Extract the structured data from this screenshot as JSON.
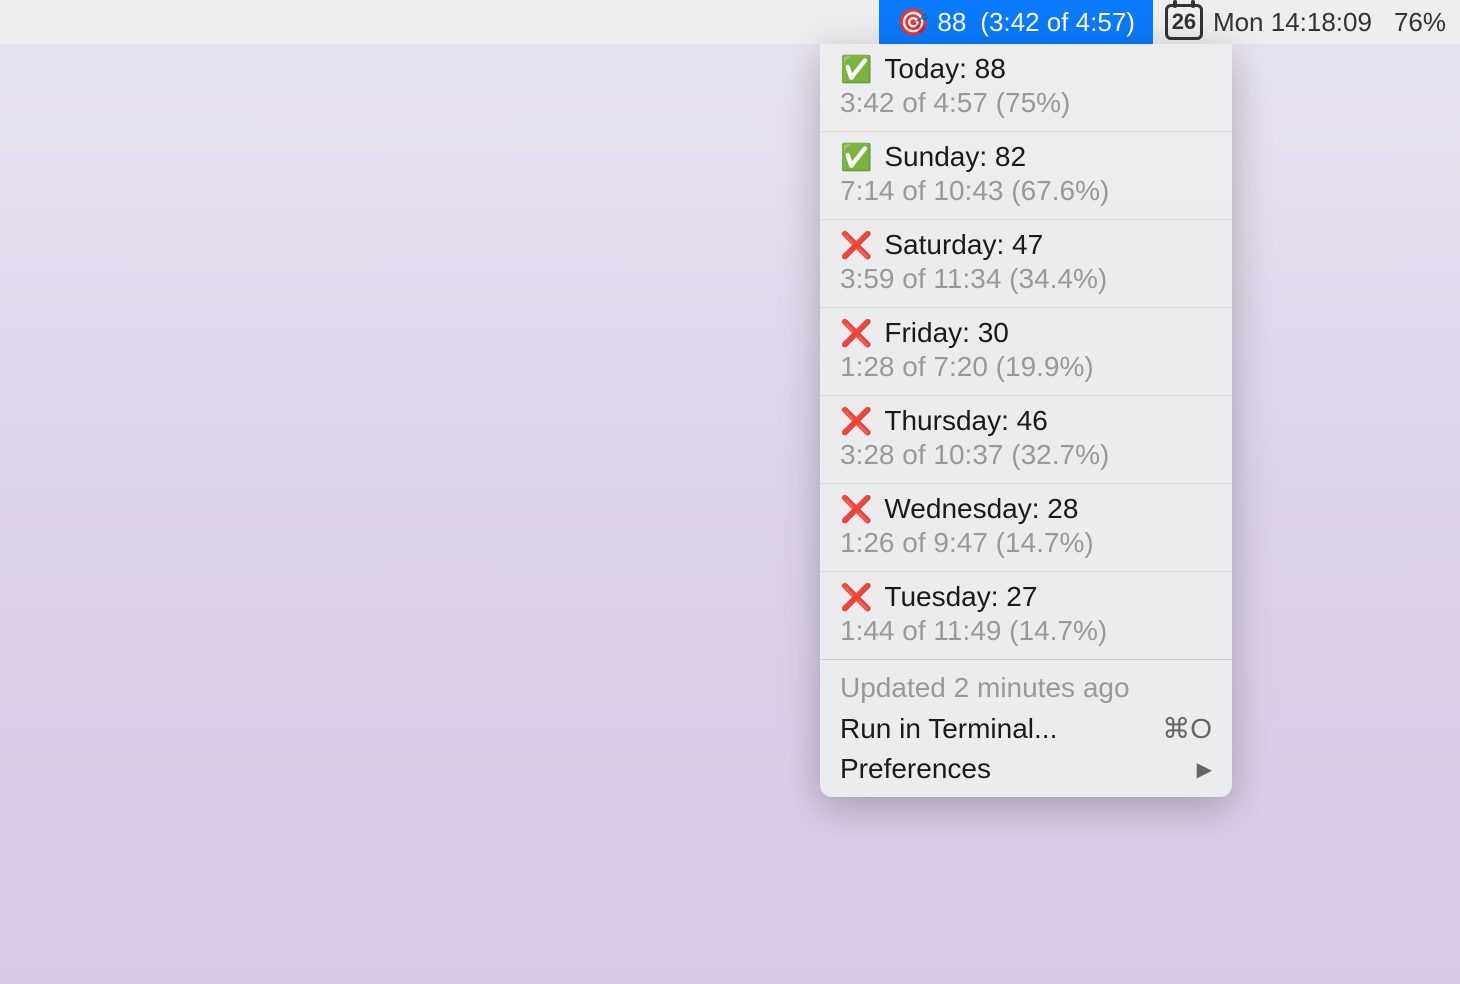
{
  "menubar": {
    "app_status": {
      "icon": "🎯",
      "score": "88",
      "time_progress": "(3:42 of 4:57)"
    },
    "calendar": {
      "date_number": "26",
      "day_time": "Mon 14:18:09"
    },
    "battery": "76%"
  },
  "dropdown": {
    "days": [
      {
        "status": "✅",
        "label": "Today: 88",
        "detail": "3:42 of 4:57 (75%)"
      },
      {
        "status": "✅",
        "label": "Sunday: 82",
        "detail": "7:14 of 10:43 (67.6%)"
      },
      {
        "status": "❌",
        "label": "Saturday: 47",
        "detail": "3:59 of 11:34 (34.4%)"
      },
      {
        "status": "❌",
        "label": "Friday: 30",
        "detail": "1:28 of 7:20 (19.9%)"
      },
      {
        "status": "❌",
        "label": "Thursday: 46",
        "detail": "3:28 of 10:37 (32.7%)"
      },
      {
        "status": "❌",
        "label": "Wednesday: 28",
        "detail": "1:26 of 9:47 (14.7%)"
      },
      {
        "status": "❌",
        "label": "Tuesday: 27",
        "detail": "1:44 of 11:49 (14.7%)"
      }
    ],
    "footer": {
      "updated_text": "Updated 2 minutes ago",
      "run_terminal": "Run in Terminal...",
      "run_terminal_shortcut": "⌘O",
      "preferences": "Preferences",
      "submenu_indicator": "▶"
    }
  }
}
